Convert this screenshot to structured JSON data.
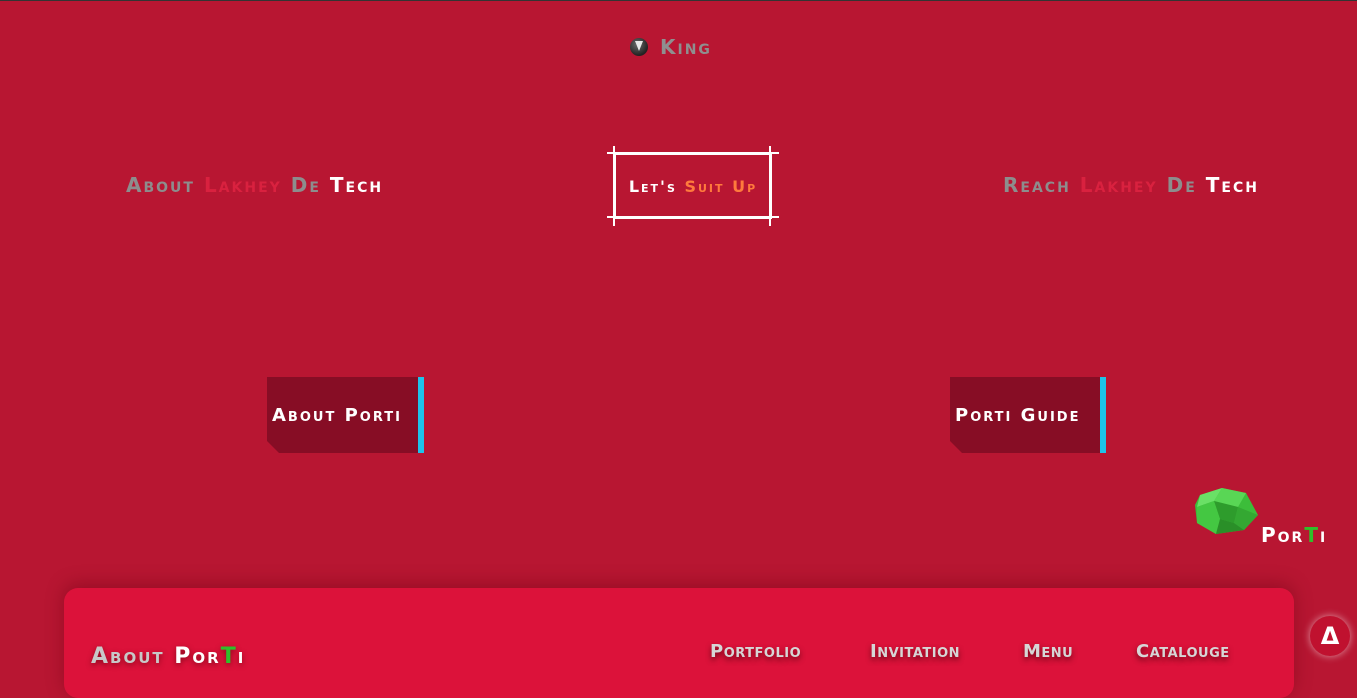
{
  "brand": {
    "name": "King",
    "icon": "shield-v-icon"
  },
  "nav": {
    "about": {
      "w1": "About",
      "w2": "Lakhey",
      "w3": "De",
      "w4": "Tech"
    },
    "suit": {
      "w1": "Let's",
      "w2": "Suit Up"
    },
    "reach": {
      "w1": "Reach",
      "w2": "Lakhey",
      "w3": "De",
      "w4": "Tech"
    }
  },
  "sections": {
    "about_label": "About Porti",
    "guide_label": "Porti Guide"
  },
  "logo": {
    "p1": "Por",
    "p2": "T",
    "p3": "i",
    "icon": "green-gem-icon"
  },
  "footer": {
    "title_w1": "About",
    "title_w2": "Por",
    "title_w3": "T",
    "title_w4": "i",
    "nav": [
      "Portfolio",
      "Invitation",
      "Menu",
      "Catalouge"
    ]
  },
  "scroll_up": {
    "label": "Δ",
    "icon": "up-arrow-icon"
  },
  "colors": {
    "background": "#b81632",
    "footer": "#dc123a",
    "button": "#870d25",
    "accent": "#1ec3ea",
    "highlight": "#d9213f",
    "orange": "#ff7a3c",
    "green": "#2fc02a"
  }
}
